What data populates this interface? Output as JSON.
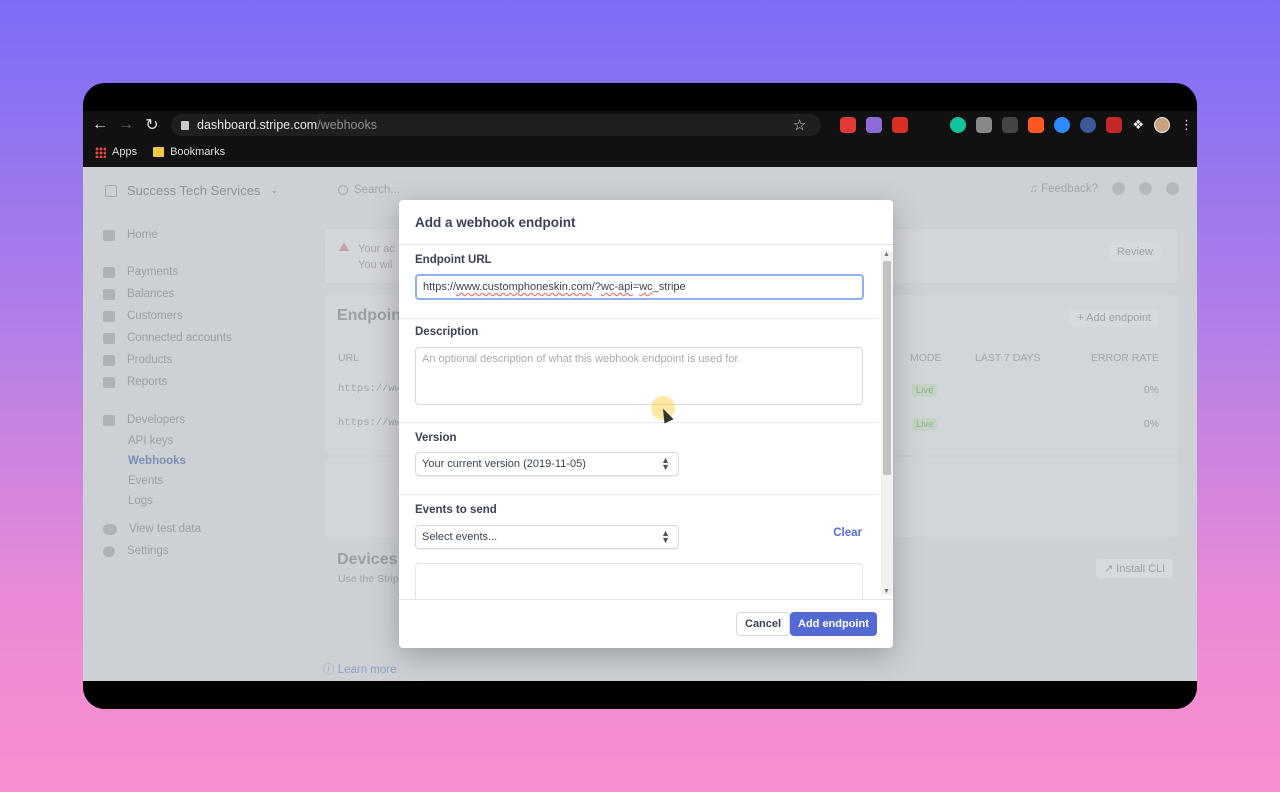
{
  "browser": {
    "url_host": "dashboard.stripe.com",
    "url_path": "/webhooks",
    "bookmarks": [
      "Apps",
      "Bookmarks"
    ],
    "extensions": [
      {
        "name": "abp-icon",
        "color": "#e53935"
      },
      {
        "name": "colorful-extension-icon",
        "color": "#8e6bd6"
      },
      {
        "name": "pdf-icon",
        "color": "#d93025"
      },
      {
        "name": "grammarly-icon",
        "color": "#15c39a"
      },
      {
        "name": "extension-gray-icon",
        "color": "#888888"
      },
      {
        "name": "sh-extension-icon",
        "color": "#444444"
      },
      {
        "name": "play-extension-icon",
        "color": "#ff5722"
      },
      {
        "name": "search-extension-icon",
        "color": "#2d8cff"
      },
      {
        "name": "shield-extension-icon",
        "color": "#3b5998"
      },
      {
        "name": "k-extension-icon",
        "color": "#c62828"
      }
    ]
  },
  "dashboard": {
    "account_name": "Success Tech Services",
    "search_placeholder": "Search...",
    "feedback_label": "Feedback?",
    "sidebar": {
      "main_items": [
        "Home",
        "Payments",
        "Balances",
        "Customers",
        "Connected accounts",
        "Products",
        "Reports"
      ],
      "developers_label": "Developers",
      "developer_items": [
        "API keys",
        "Webhooks",
        "Events",
        "Logs"
      ],
      "active_item": "Webhooks",
      "bottom_items": [
        "View test data",
        "Settings"
      ]
    },
    "alert": {
      "line1": "Your ac",
      "line2": "You wil",
      "review_label": "Review"
    },
    "endpoints": {
      "title": "Endpoin",
      "add_label": "+ Add endpoint",
      "columns": [
        "URL",
        "MODE",
        "LAST 7 DAYS",
        "ERROR RATE"
      ],
      "rows": [
        {
          "url": "https://ww",
          "mode": "Live",
          "error_rate": "0%"
        },
        {
          "url": "https://ww",
          "mode": "Live",
          "error_rate": "0%"
        }
      ]
    },
    "devices": {
      "title": "Devices",
      "subtitle": "Use the Strip",
      "install_label": "Install CLI"
    },
    "learn_more": "Learn more"
  },
  "modal": {
    "title": "Add a webhook endpoint",
    "endpoint_url_label": "Endpoint URL",
    "endpoint_url_value_parts": [
      "https://",
      "www.customphoneskin.com",
      "/?",
      "wc-api",
      "=",
      "wc",
      "_stripe"
    ],
    "description_label": "Description",
    "description_placeholder": "An optional description of what this webhook endpoint is used for.",
    "version_label": "Version",
    "version_value": "Your current version (2019-11-05)",
    "events_label": "Events to send",
    "events_placeholder": "Select events...",
    "clear_label": "Clear",
    "cancel_label": "Cancel",
    "add_label": "Add endpoint"
  }
}
